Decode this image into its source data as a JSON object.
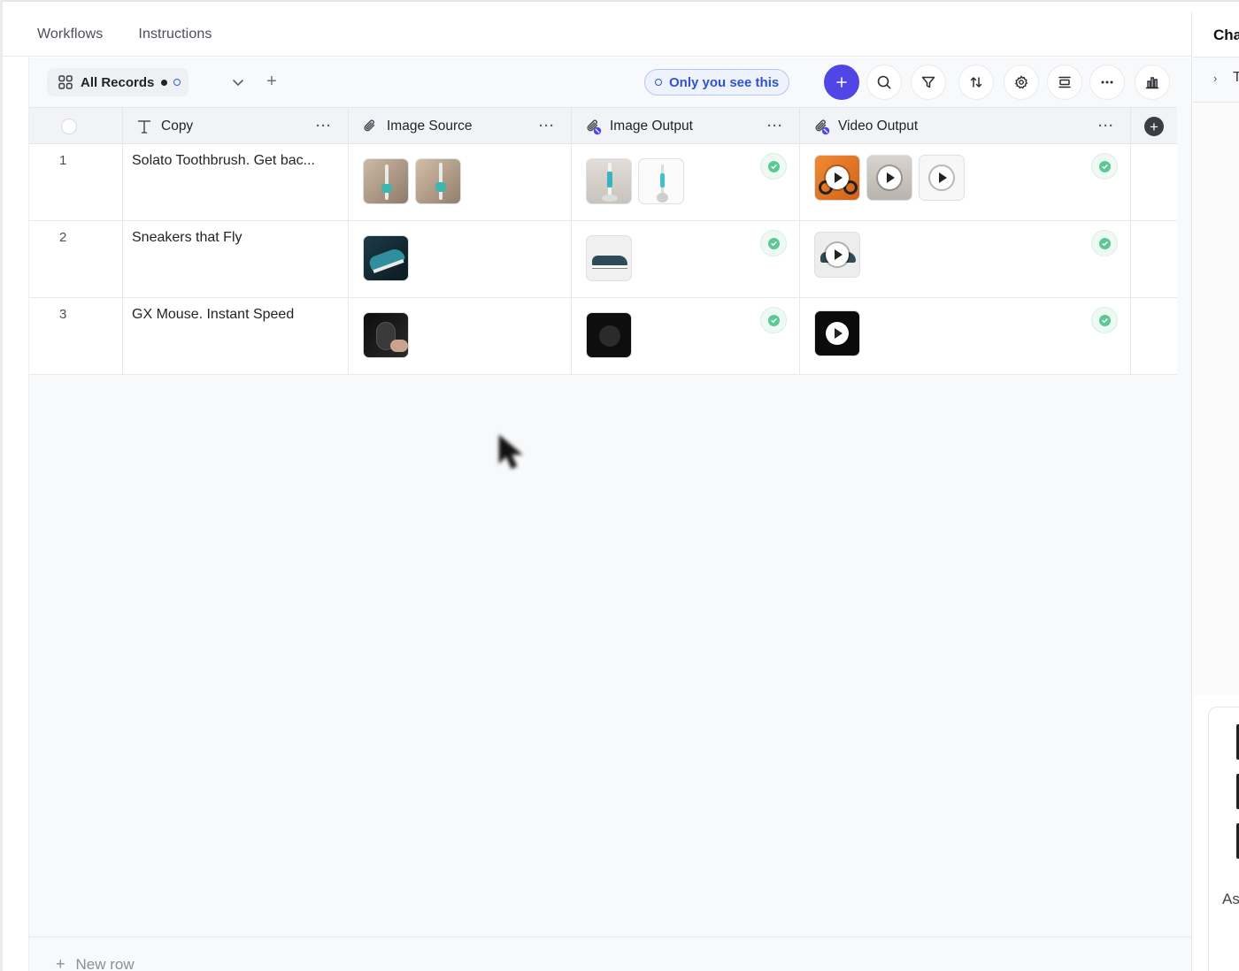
{
  "tabs": [
    "Workflows",
    "Instructions"
  ],
  "toolbar": {
    "view_label": "All Records",
    "visibility_label": "Only you see this",
    "icons": [
      "plus-icon",
      "search-icon",
      "filter-icon",
      "sort-icon",
      "settings-icon",
      "row-height-icon",
      "more-icon",
      "chart-icon"
    ]
  },
  "table": {
    "columns": [
      {
        "label": "Copy",
        "icon": "text-icon"
      },
      {
        "label": "Image Source",
        "icon": "attachment-icon"
      },
      {
        "label": "Image Output",
        "icon": "ai-attachment-icon"
      },
      {
        "label": "Video Output",
        "icon": "ai-attachment-icon"
      }
    ],
    "rows": [
      {
        "num": "1",
        "copy": "Solato Toothbrush. Get bac..."
      },
      {
        "num": "2",
        "copy": "Sneakers that Fly"
      },
      {
        "num": "3",
        "copy": "GX Mouse. Instant Speed"
      }
    ],
    "new_row_label": "New row"
  },
  "right_panel": {
    "title": "Cha",
    "sub": "T",
    "bottom_text": "As"
  },
  "colors": {
    "accent": "#4f46e5",
    "badge_text": "#3152c8",
    "status_green": "#5cc896"
  }
}
